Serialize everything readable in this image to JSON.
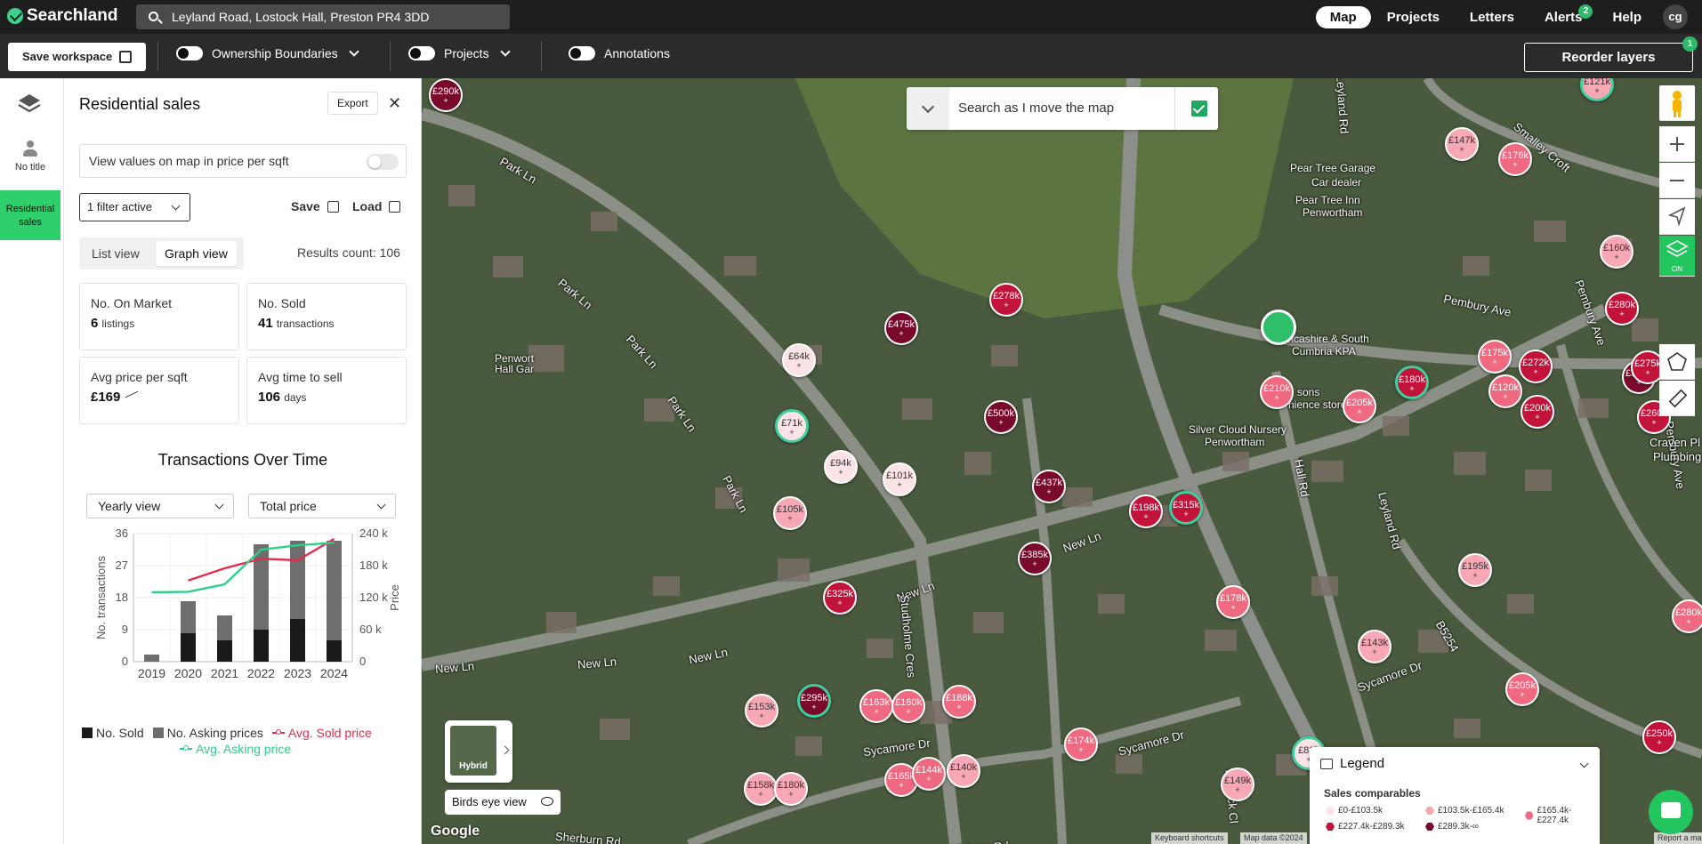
{
  "app": {
    "name": "Searchland",
    "search_value": "Leyland Road, Lostock Hall, Preston PR4 3DD"
  },
  "nav": {
    "map": "Map",
    "projects": "Projects",
    "letters": "Letters",
    "alerts": "Alerts",
    "alerts_count": "2",
    "help": "Help",
    "avatar": "cg"
  },
  "toolbar": {
    "save_workspace": "Save workspace",
    "ownership": "Ownership Boundaries",
    "projects": "Projects",
    "annotations": "Annotations",
    "reorder_layers": "Reorder layers",
    "reorder_count": "1"
  },
  "rail": {
    "no_title": "No title",
    "residential_sales": "Residential sales"
  },
  "panel": {
    "title": "Residential sales",
    "export": "Export",
    "price_per_sqft": "View values on map in price per sqft",
    "filter": "1 filter active",
    "save": "Save",
    "load": "Load",
    "list_view": "List view",
    "graph_view": "Graph view",
    "results_count": "Results count: 106",
    "stats": {
      "on_market_label": "No. On Market",
      "on_market_value": "6",
      "on_market_unit": "listings",
      "sold_label": "No. Sold",
      "sold_value": "41",
      "sold_unit": "transactions",
      "avg_sqft_label": "Avg price per sqft",
      "avg_sqft_value": "£169",
      "avg_time_label": "Avg time to sell",
      "avg_time_value": "106",
      "avg_time_unit": "days"
    },
    "chart_title": "Transactions Over Time",
    "view_select": "Yearly view",
    "price_select": "Total price"
  },
  "chart_data": {
    "type": "bar",
    "title": "Transactions Over Time",
    "categories": [
      "2019",
      "2020",
      "2021",
      "2022",
      "2023",
      "2024"
    ],
    "ylabel": "No. transactions",
    "y2label": "Price",
    "ylim": [
      0,
      36
    ],
    "y2lim": [
      0,
      240000
    ],
    "yticks": [
      "0",
      "9",
      "18",
      "27",
      "36"
    ],
    "y2ticks": [
      "0",
      "60 k",
      "120 k",
      "180 k",
      "240 k"
    ],
    "series": [
      {
        "name": "No. Sold",
        "kind": "bar",
        "color": "#1a1a1a",
        "values": [
          0,
          8,
          6,
          9,
          12,
          6
        ]
      },
      {
        "name": "No. Asking prices",
        "kind": "bar",
        "color": "#6e6e6e",
        "values": [
          2,
          9,
          7,
          24,
          22,
          28
        ]
      },
      {
        "name": "Avg. Sold price",
        "kind": "line",
        "color": "#e0304e",
        "values": [
          null,
          152000,
          175000,
          193000,
          190000,
          230000
        ]
      },
      {
        "name": "Avg. Asking price",
        "kind": "line",
        "color": "#2fcf8a",
        "values": [
          130000,
          131000,
          145000,
          210000,
          218000,
          223000
        ]
      }
    ],
    "legend": [
      "No. Sold",
      "No. Asking prices",
      "Avg. Sold price",
      "Avg. Asking price"
    ]
  },
  "map": {
    "search_as_move": "Search as I move the map",
    "hybrid": "Hybrid",
    "birds_eye": "Birds eye view",
    "google": "Google",
    "attrib_shortcuts": "Keyboard shortcuts",
    "attrib_data": "Map data ©2024",
    "attrib_error": "Report a map error",
    "labels": [
      "Park Ln",
      "Park Ln",
      "Park Ln",
      "Park Ln",
      "Park Ln",
      "New Ln",
      "New Ln",
      "New Ln",
      "New Ln",
      "New Ln",
      "Leyland Rd",
      "Leyland Rd",
      "Hall Rd",
      "Studholme Cres",
      "Sycamore Dr",
      "Sycamore Dr",
      "Sycamore Dr",
      "Parrock Cl",
      "Pembury Ave",
      "Pembury Ave",
      "Pembury Ave",
      "Smalley Croft",
      "B5254",
      "Sherburn Rd",
      "Sherburn Rd",
      "Craven Pl",
      "Plumbing"
    ],
    "places": [
      "Pear Tree Garage",
      "Car dealer",
      "Pear Tree Inn",
      "Penwortham",
      "Lancashire & South",
      "Cumbria KPA",
      "Silver Cloud Nursery",
      "Penwortham",
      "Penwort",
      "Hall Gar",
      "sons",
      "nience store"
    ],
    "pins": [
      "£290k",
      "£121k",
      "£147k",
      "£176k",
      "£160k",
      "£278k",
      "£475k",
      "£64k",
      "£71k",
      "£500k",
      "£210k",
      "£180k",
      "£205k",
      "£175k",
      "£272k",
      "£120k",
      "£200k",
      "£310k",
      "£280k",
      "£275k",
      "£260k",
      "£94k",
      "£101k",
      "£105k",
      "£437k",
      "£198k",
      "£315k",
      "£385k",
      "£325k",
      "£178k",
      "£195k",
      "£143k",
      "£205k",
      "£280k",
      "£153k",
      "£295k",
      "£163k",
      "£160k",
      "£188k",
      "£174k",
      "£81k",
      "£158k",
      "£180k",
      "£165k",
      "£144k",
      "£140k",
      "£149k",
      "£160k",
      "£250k"
    ]
  },
  "legend": {
    "title": "Legend",
    "subtitle": "Sales comparables",
    "items": [
      "£0-£103.5k",
      "£103.5k-£165.4k",
      "£165.4k-£227.4k",
      "£227.4k-£289.3k",
      "£289.3k-∞"
    ],
    "colors": [
      "#fbe3e6",
      "#f7a8b4",
      "#ef6a80",
      "#c2143a",
      "#7a0a2c"
    ]
  }
}
